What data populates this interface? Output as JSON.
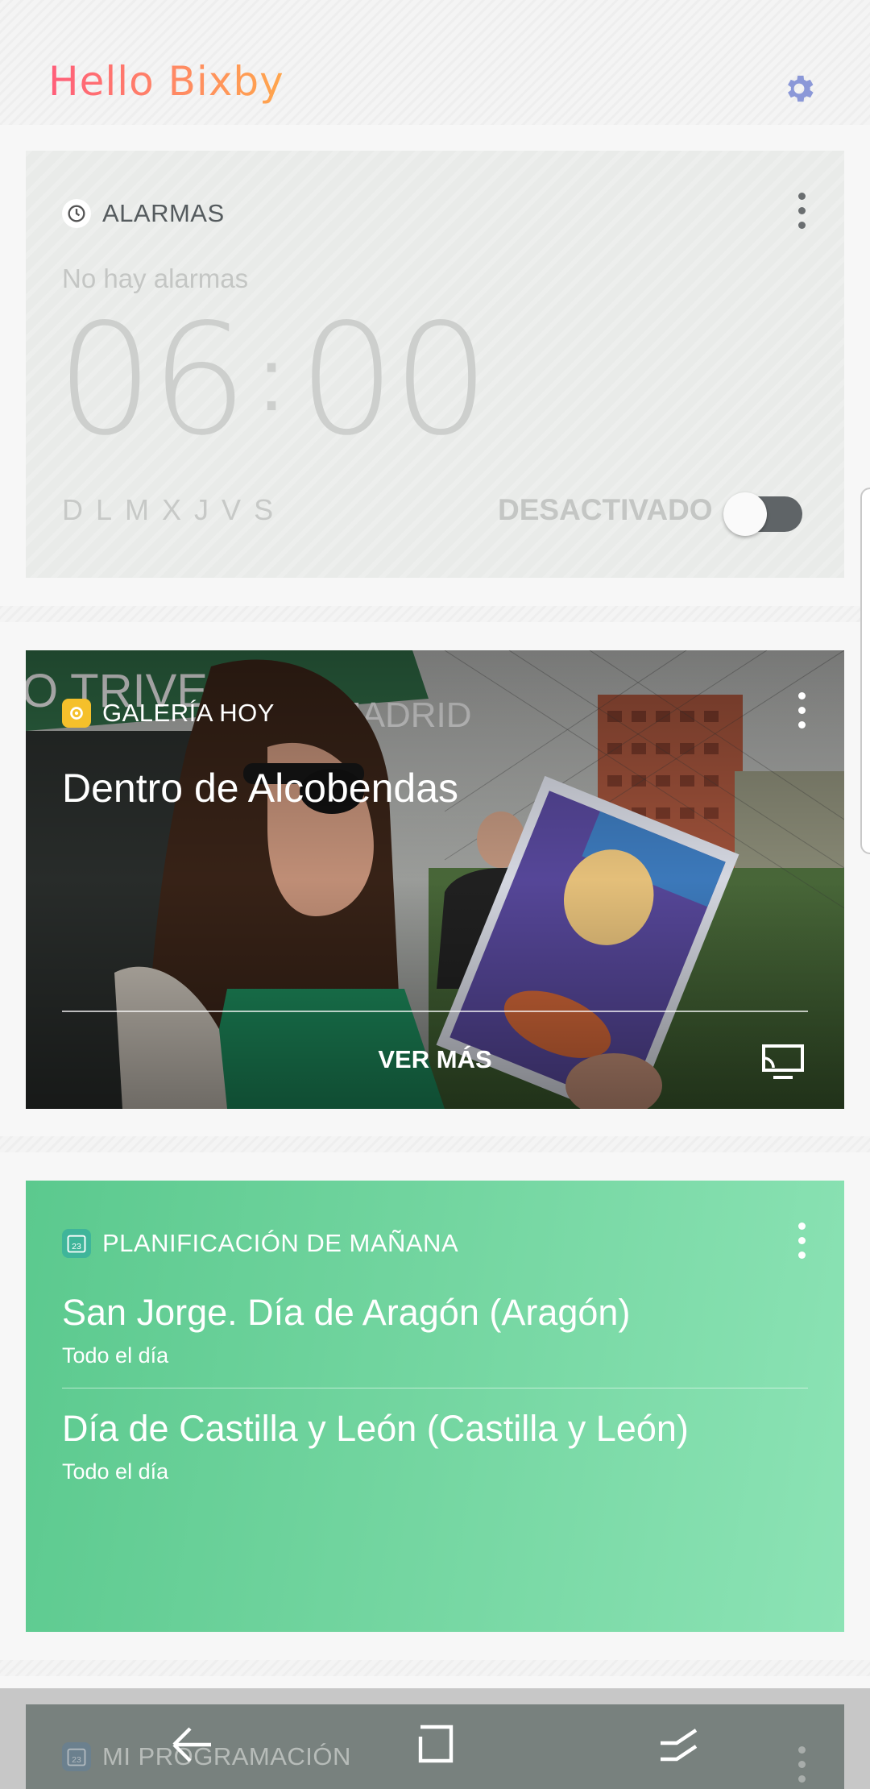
{
  "header": {
    "logo": "Hello Bixby"
  },
  "alarm_card": {
    "label": "ALARMAS",
    "empty": "No hay alarmas",
    "hour": "06",
    "minute": "00",
    "days": [
      "D",
      "L",
      "M",
      "X",
      "J",
      "V",
      "S"
    ],
    "status": "DESACTIVADO",
    "enabled": false
  },
  "gallery_card": {
    "label": "GALERÍA HOY",
    "title": "Dentro de Alcobendas",
    "more": "VER MÁS"
  },
  "plan_card": {
    "label": "PLANIFICACIÓN DE MAÑANA",
    "events": [
      {
        "title": "San Jorge. Día de Aragón (Aragón)",
        "sub": "Todo el día"
      },
      {
        "title": "Día de Castilla y León (Castilla y León)",
        "sub": "Todo el día"
      }
    ]
  },
  "schedule_card": {
    "label": "MI PROGRAMACIÓN"
  },
  "calendar_icon_day": "23",
  "colors": {
    "accent": "#8b98d8",
    "plan_green": "#74d6a1",
    "logo_pink": "#ff5d7a",
    "logo_orange": "#ffa64c"
  }
}
